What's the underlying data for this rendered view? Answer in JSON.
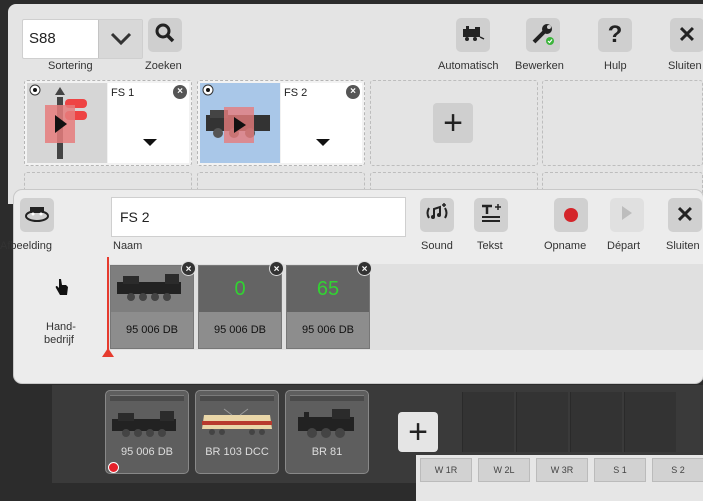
{
  "top": {
    "select_value": "S88",
    "sort_label": "Sortering",
    "search_label": "Zoeken",
    "auto_label": "Automatisch",
    "edit_label": "Bewerken",
    "help_label": "Hulp",
    "help_glyph": "?",
    "close_label": "Sluiten",
    "close_glyph": "✕",
    "fs_cards": [
      {
        "name": "FS 1",
        "x": "×"
      },
      {
        "name": "FS 2",
        "x": "×"
      }
    ],
    "plus_glyph": "+"
  },
  "editor": {
    "image_label": "Afbeelding",
    "name_value": "FS 2",
    "name_label": "Naam",
    "sound_label": "Sound",
    "text_label": "Tekst",
    "record_label": "Opname",
    "depart_label": "Départ",
    "close_label": "Sluiten",
    "close_glyph": "✕",
    "hand_label_1": "Hand-",
    "hand_label_2": "bedrijf",
    "events": [
      {
        "value": "",
        "label": "95 006 DB",
        "x": "×"
      },
      {
        "value": "0",
        "label": "95 006 DB",
        "x": "×"
      },
      {
        "value": "65",
        "label": "95 006 DB",
        "x": "×"
      }
    ]
  },
  "locos": [
    {
      "name": "95 006 DB"
    },
    {
      "name": "BR 103 DCC"
    },
    {
      "name": "BR 81"
    }
  ],
  "loco_plus": "+",
  "switch_tabs": [
    "W 1R",
    "W 2L",
    "W 3R",
    "S 1",
    "S 2"
  ],
  "colors": {
    "accent_red": "#e63b2e",
    "speed_green": "#32d232",
    "status_green": "#3cb43c"
  }
}
